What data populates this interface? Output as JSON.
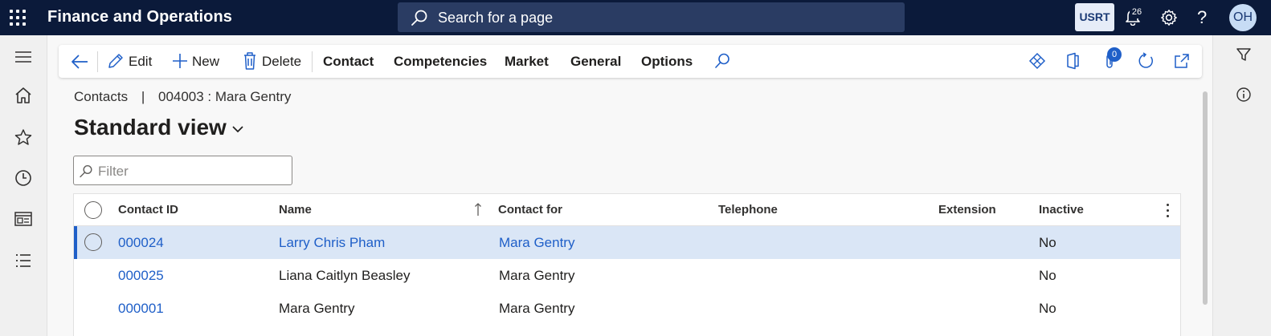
{
  "topbar": {
    "app_title": "Finance and Operations",
    "search_placeholder": "Search for a page",
    "company": "USRT",
    "notification_count": "26",
    "help_glyph": "?",
    "avatar_initials": "OH",
    "icons": [
      "waffle-icon",
      "search-icon",
      "bell-icon",
      "gear-icon",
      "help-icon"
    ]
  },
  "leftnav": {
    "icons": [
      "hamburger-icon",
      "home-icon",
      "star-icon",
      "clock-icon",
      "workspace-icon",
      "list-icon"
    ]
  },
  "actionpane": {
    "edit_label": "Edit",
    "new_label": "New",
    "delete_label": "Delete",
    "tabs": [
      "Contact",
      "Competencies",
      "Market",
      "General",
      "Options"
    ],
    "attachment_count": "0"
  },
  "breadcrumb": {
    "root": "Contacts",
    "separator": "|",
    "current": "004003 : Mara Gentry"
  },
  "view": {
    "title": "Standard view"
  },
  "filter": {
    "placeholder": "Filter"
  },
  "grid": {
    "columns": [
      "Contact ID",
      "Name",
      "Contact for",
      "Telephone",
      "Extension",
      "Inactive"
    ],
    "rows": [
      {
        "contact_id": "000024",
        "name": "Larry Chris Pham",
        "contact_for": "Mara Gentry",
        "telephone": "",
        "extension": "",
        "inactive": "No",
        "selected": true
      },
      {
        "contact_id": "000025",
        "name": "Liana Caitlyn Beasley",
        "contact_for": "Mara Gentry",
        "telephone": "",
        "extension": "",
        "inactive": "No",
        "selected": false
      },
      {
        "contact_id": "000001",
        "name": "Mara Gentry",
        "contact_for": "Mara Gentry",
        "telephone": "",
        "extension": "",
        "inactive": "No",
        "selected": false
      }
    ]
  },
  "colors": {
    "topbar": "#0b1a3a",
    "accent": "#1f5fc8",
    "selected_row": "#dae6f6"
  }
}
